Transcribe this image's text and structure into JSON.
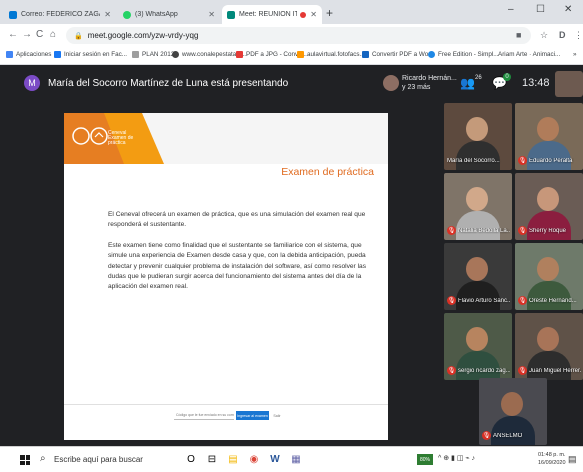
{
  "browser": {
    "tabs": [
      {
        "label": "Correo: FEDERICO ZAGAL LEÓN",
        "active": false
      },
      {
        "label": "(3) WhatsApp",
        "active": false
      },
      {
        "label": "Meet: REUNION IT ACAPUL",
        "active": true
      }
    ],
    "new_tab": "+",
    "window_controls": {
      "minimize": "–",
      "maximize": "☐",
      "close": "✕"
    },
    "nav": {
      "back": "←",
      "forward": "→",
      "reload": "C",
      "home": "⌂"
    },
    "url": "meet.google.com/yzw-vrdy-yqg",
    "toolbar_icons": {
      "camera": "■",
      "star": "☆",
      "profile": "D",
      "menu": "⋮"
    },
    "bookmarks": [
      {
        "label": "Aplicaciones",
        "color": "#4285f4"
      },
      {
        "label": "Iniciar sesión en Fac...",
        "color": "#1877f2"
      },
      {
        "label": "PLAN 2012",
        "color": "#9e9e9e"
      },
      {
        "label": "www.conalepestatal.c...",
        "color": "#424242"
      },
      {
        "label": "PDF a JPG - Conver...",
        "color": "#e53935"
      },
      {
        "label": "aulavirtual.fotofacs...",
        "color": "#ff9800"
      },
      {
        "label": "Convertir PDF a Wo...",
        "color": "#1565c0"
      },
      {
        "label": "Free Edition - Simpl...",
        "color": "#1e88e5"
      },
      {
        "label": "Ariam Arte · Animaci...",
        "color": "#757575"
      }
    ],
    "bookmarks_more": "»"
  },
  "meet": {
    "presenter_initial": "M",
    "presenting_text": "María del Socorro Martínez de Luna está presentando",
    "header_user_name": "Ricardo Hernán...",
    "header_user_sub": "y 23 más",
    "participants_icon": "👥",
    "participants_count": "26",
    "chat_icon": "💬",
    "chat_badge": "0",
    "time": "13:48"
  },
  "slide": {
    "logo_text_line1": "Ceneval",
    "logo_text_line2": "Examen de",
    "logo_text_line3": "práctica",
    "title": "Examen de práctica",
    "p1": "El Ceneval ofrecerá un examen de práctica, que es una simulación del examen real que responderá el sustentante.",
    "p2": "Este examen tiene como finalidad que el sustentante se familiarice con el sistema, que simule una experiencia de Examen desde casa y que, con la debida anticipación, pueda detectar y prevenir cualquier problema de instalación del software, así como resolver las dudas que le pudieran surgir acerca del funcionamiento del sistema antes del día de la aplicación del examen real.",
    "input_placeholder": "Código que le fue enviado en su correo",
    "primary_button": "Ingresar al examen",
    "secondary_button": "Salir"
  },
  "participants": [
    {
      "name": "María del Socorro...",
      "muted": false,
      "bg": "#5d4a3e",
      "skin": "#c49a7a",
      "shirt": "#2f2f2f"
    },
    {
      "name": "Eduardo Peralta",
      "muted": true,
      "bg": "#7a6a58",
      "skin": "#b07c5a",
      "shirt": "#4b6a8a"
    },
    {
      "name": "Natalia Bedolla La...",
      "muted": true,
      "bg": "#7f7468",
      "skin": "#d1a88a",
      "shirt": "#b0b0b0"
    },
    {
      "name": "Sherry Roque",
      "muted": true,
      "bg": "#6a5c55",
      "skin": "#c7977a",
      "shirt": "#8b1e3f"
    },
    {
      "name": "Flavio Arturo Sánc...",
      "muted": true,
      "bg": "#3a3a3a",
      "skin": "#a8765a",
      "shirt": "#1f1f1f"
    },
    {
      "name": "Oreste Hernánd...",
      "muted": true,
      "bg": "#6e7a6a",
      "skin": "#b0805e",
      "shirt": "#3d5a3d"
    },
    {
      "name": "sergio ricardo zag...",
      "muted": true,
      "bg": "#4e5a48",
      "skin": "#b7845f",
      "shirt": "#2f4f3f"
    },
    {
      "name": "Juan Miguel Herrer...",
      "muted": true,
      "bg": "#5f5248",
      "skin": "#a87458",
      "shirt": "#2d2d2d"
    },
    {
      "name": "ANSELMO",
      "muted": true,
      "bg": "#4a4a50",
      "skin": "#9b6b50",
      "shirt": "#1e2a3a"
    }
  ],
  "taskbar": {
    "search_icon": "⌕",
    "search_placeholder": "Escribe aquí para buscar",
    "apps": [
      {
        "icon": "O",
        "name": "cortana"
      },
      {
        "icon": "⊟",
        "name": "task-view"
      },
      {
        "icon": "▤",
        "name": "file-explorer"
      },
      {
        "icon": "◉",
        "name": "chrome"
      },
      {
        "icon": "W",
        "name": "word"
      },
      {
        "icon": "▦",
        "name": "teams"
      }
    ],
    "battery_badge": "80%",
    "tray_icons": "^ ⊕ ▮ ◫ ⌁ ♪",
    "time": "01:48 p. m.",
    "date": "16/09/2020",
    "notification_icon": "▤"
  },
  "colors": {
    "meet_bg": "#202124",
    "slide_accent": "#e06b20",
    "logo_orange": "#f39c12"
  }
}
